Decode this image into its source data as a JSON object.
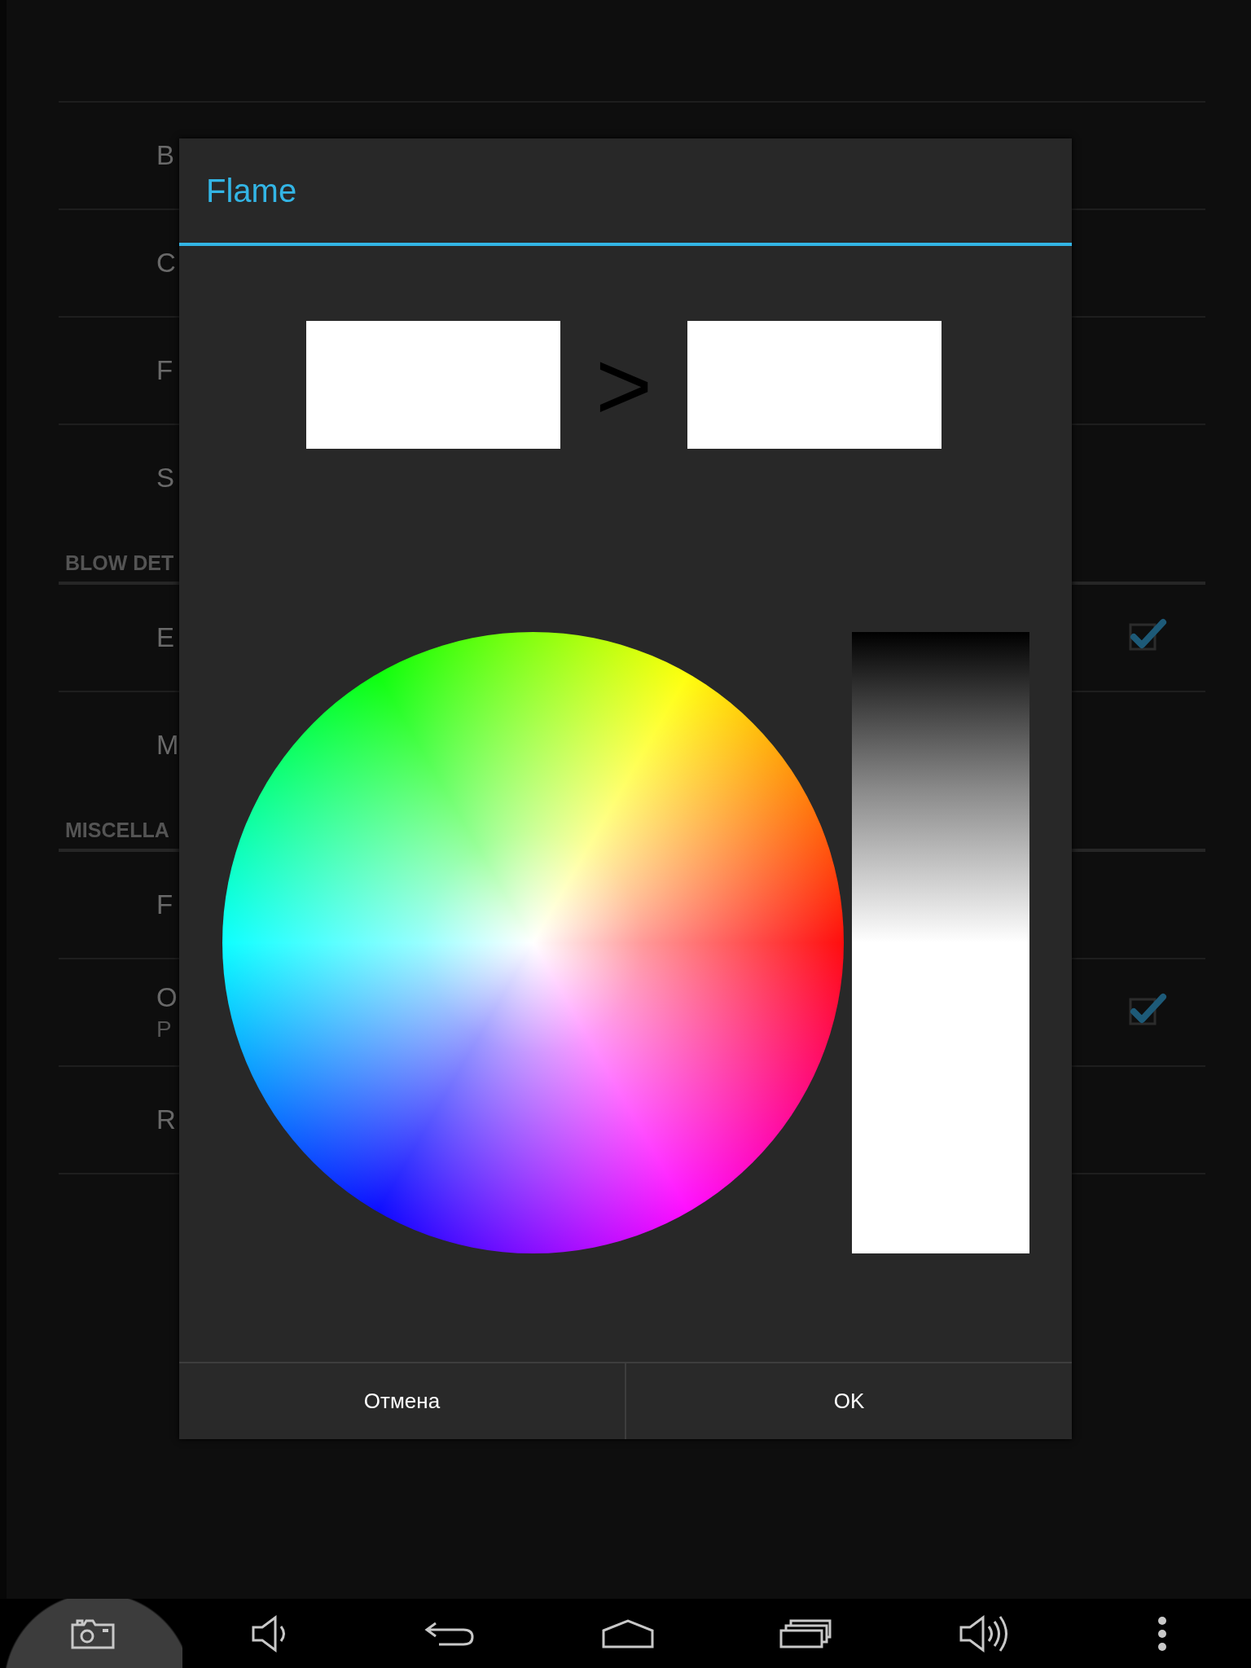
{
  "preferences": [
    {
      "kind": "item",
      "title": "B"
    },
    {
      "kind": "item",
      "title": "C"
    },
    {
      "kind": "item",
      "title": "F"
    },
    {
      "kind": "item",
      "title": "S"
    },
    {
      "kind": "header",
      "title": "BLOW DET"
    },
    {
      "kind": "checkbox",
      "title": "E",
      "checked": true
    },
    {
      "kind": "item",
      "title": "M"
    },
    {
      "kind": "header",
      "title": "MISCELLA"
    },
    {
      "kind": "item",
      "title": "F"
    },
    {
      "kind": "checkbox",
      "title": "O",
      "summary": "P",
      "checked": true
    },
    {
      "kind": "item",
      "title": "R"
    }
  ],
  "dialog": {
    "title": "Flame",
    "swatches": [
      {
        "color": "#ffffff"
      },
      {
        "color": "#ffffff"
      }
    ],
    "arrow": ">",
    "buttons": [
      "Отмена",
      "OK"
    ]
  }
}
